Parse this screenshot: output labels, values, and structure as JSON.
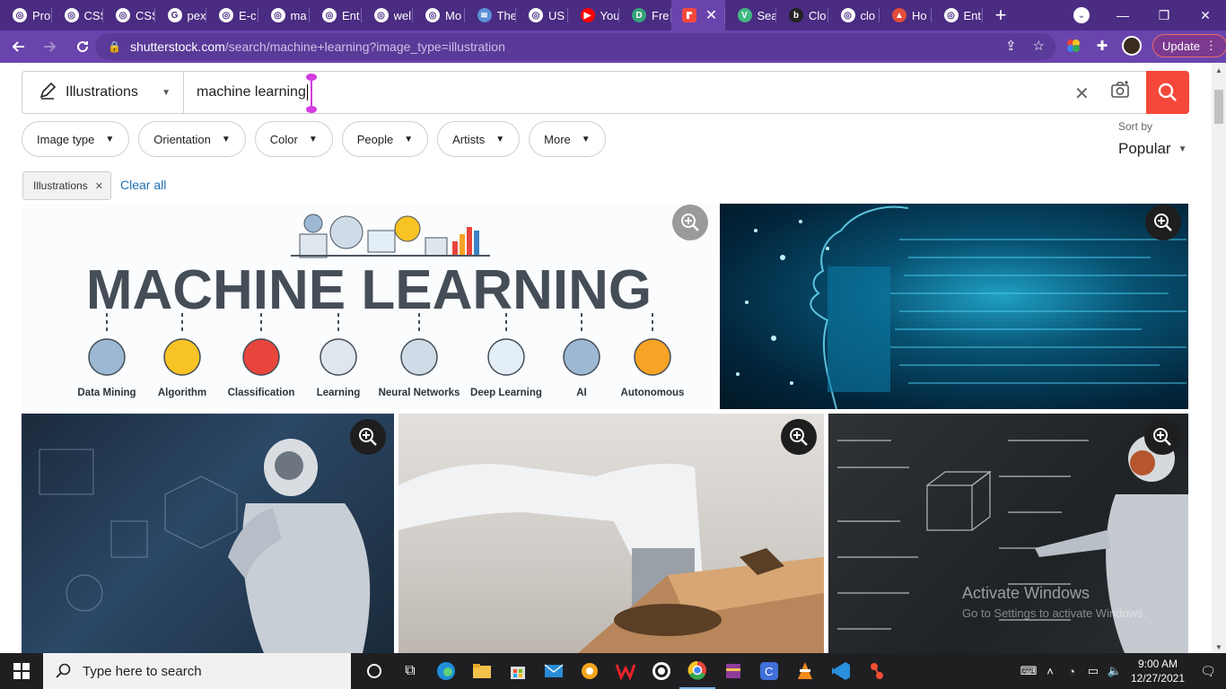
{
  "browser": {
    "tabs": [
      {
        "label": "Pro",
        "icon": "globe-icon",
        "fav_text": "◎",
        "fav_bg": "#ffffff"
      },
      {
        "label": "CSS",
        "icon": "globe-icon",
        "fav_text": "◎",
        "fav_bg": "#ffffff"
      },
      {
        "label": "CSS",
        "icon": "globe-icon",
        "fav_text": "◎",
        "fav_bg": "#ffffff"
      },
      {
        "label": "pex",
        "icon": "google-icon",
        "fav_text": "G",
        "fav_bg": "#ffffff"
      },
      {
        "label": "E-c",
        "icon": "globe-icon",
        "fav_text": "◎",
        "fav_bg": "#ffffff"
      },
      {
        "label": "ma",
        "icon": "globe-icon",
        "fav_text": "◎",
        "fav_bg": "#ffffff"
      },
      {
        "label": "Ent",
        "icon": "globe-icon",
        "fav_text": "◎",
        "fav_bg": "#ffffff"
      },
      {
        "label": "wel",
        "icon": "globe-icon",
        "fav_text": "◎",
        "fav_bg": "#ffffff"
      },
      {
        "label": "Mo",
        "icon": "globe-icon",
        "fav_text": "◎",
        "fav_bg": "#ffffff"
      },
      {
        "label": "The",
        "icon": "stripes-icon",
        "fav_text": "≋",
        "fav_bg": "#5b8fd6"
      },
      {
        "label": "US",
        "icon": "globe-icon",
        "fav_text": "◎",
        "fav_bg": "#ffffff"
      },
      {
        "label": "You",
        "icon": "youtube-icon",
        "fav_text": "▶",
        "fav_bg": "#ff0000"
      },
      {
        "label": "Fre",
        "icon": "letter-d-icon",
        "fav_text": "D",
        "fav_bg": "#35a37a"
      }
    ],
    "active_tab": {
      "icon": "shutterstock-icon",
      "close": "✕"
    },
    "tabs_after": [
      {
        "label": "Sea",
        "icon": "vue-icon",
        "fav_text": "V",
        "fav_bg": "#41b883"
      },
      {
        "label": "Clo",
        "icon": "letter-b-icon",
        "fav_text": "b",
        "fav_bg": "#222222"
      },
      {
        "label": "clo",
        "icon": "globe-icon",
        "fav_text": "◎",
        "fav_bg": "#ffffff"
      },
      {
        "label": "Ho",
        "icon": "triangle-icon",
        "fav_text": "▲",
        "fav_bg": "#e34c3c"
      },
      {
        "label": "Ent",
        "icon": "globe-icon",
        "fav_text": "◎",
        "fav_bg": "#ffffff"
      }
    ],
    "new_tab": "+",
    "window": {
      "minimize": "—",
      "restore": "❐",
      "close": "✕"
    },
    "url_host": "shutterstock.com",
    "url_path": "/search/machine+learning?image_type=illustration",
    "update_label": "Update",
    "colors": {
      "tabstrip": "#4a2c82",
      "toolbar": "#6a44ad",
      "accent": "#f5483b"
    }
  },
  "search": {
    "type_label": "Illustrations",
    "query": "machine learning"
  },
  "filters": [
    {
      "label": "Image type"
    },
    {
      "label": "Orientation"
    },
    {
      "label": "Color"
    },
    {
      "label": "People"
    },
    {
      "label": "Artists"
    },
    {
      "label": "More"
    }
  ],
  "sort": {
    "label": "Sort by",
    "value": "Popular"
  },
  "active_filters": {
    "chip": "Illustrations",
    "clear_all": "Clear all"
  },
  "banner": {
    "title": "MACHINE LEARNING",
    "topics": [
      "Data Mining",
      "Algorithm",
      "Classification",
      "Learning",
      "Neural Networks",
      "Deep Learning",
      "AI",
      "Autonomous"
    ]
  },
  "watermark": {
    "line1": "Activate Windows",
    "line2": "Go to Settings to activate Windows."
  },
  "taskbar": {
    "search_placeholder": "Type here to search",
    "time": "9:00 AM",
    "date": "12/27/2021"
  }
}
